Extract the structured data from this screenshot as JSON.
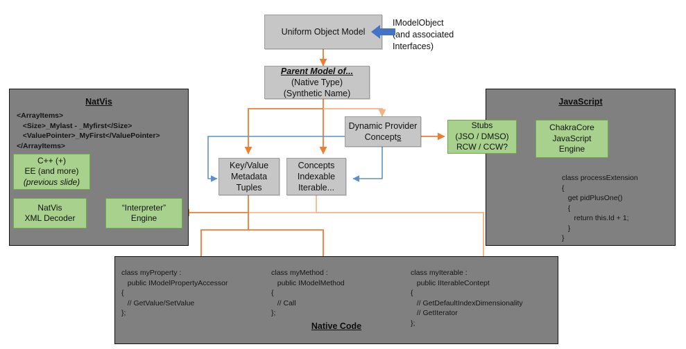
{
  "colors": {
    "panel_bg": "#808080",
    "gray_box": "#c6c6c6",
    "green_box": "#a9d18e",
    "green_border": "#6fa94a",
    "orange": "#ED7D31",
    "orange_light": "#F4B183",
    "blue": "#4472C4",
    "blue_line": "#5B8FCF"
  },
  "top": {
    "uniform_object_model": "Uniform Object Model",
    "annotation": "IModelObject\n(and associated\nInterfaces)",
    "arrow_icon": "left-arrow-icon"
  },
  "parent_model": {
    "title": "Parent Model of...",
    "line2": "(Native Type)",
    "line3": "(Synthetic Name)"
  },
  "center": {
    "dynamic_provider": {
      "line1": "Dynamic Provider",
      "line2_pre": "Concept",
      "line2_emph": "s"
    },
    "key_value": {
      "line1": "Key/Value",
      "line2": "Metadata",
      "line3": "Tuples"
    },
    "concepts": {
      "line1": "Concepts",
      "line2": "Indexable",
      "line3": "Iterable..."
    }
  },
  "natvis": {
    "title": "NatVis",
    "xml": "<ArrayItems>\n   <Size>_Mylast - _Myfirst</Size>\n   <ValuePointer>_MyFirst</ValuePointer>\n</ArrayItems>",
    "cpp_box": {
      "line1": "C++ (+)",
      "line2": "EE (and more)",
      "line3": "(previous slide)"
    },
    "decoder_box": {
      "line1": "NatVis",
      "line2": "XML Decoder"
    },
    "interpreter_box": {
      "line1": "“Interpreter”",
      "line2": "Engine"
    }
  },
  "javascript": {
    "title": "JavaScript",
    "stubs_box": {
      "line1": "Stubs",
      "line2": "(JSO / DMSO)",
      "line3": "RCW / CCW?"
    },
    "chakra_box": {
      "line1": "ChakraCore",
      "line2": "JavaScript",
      "line3": "Engine"
    },
    "code": "class processExtension\n{\n   get pidPlusOne()\n   {\n      return this.Id + 1;\n   }\n}"
  },
  "native_code": {
    "title": "Native Code",
    "block1": "class myProperty :\n   public IModelPropertyAccessor\n{\n   // GetValue/SetValue\n};",
    "block2": "class myMethod :\n   public IModelMethod\n{\n   // Call\n};",
    "block3": "class myIterable :\n   public IIterableContept\n{\n   // GetDefaultIndexDimensionality\n   // GetIterator\n};"
  }
}
